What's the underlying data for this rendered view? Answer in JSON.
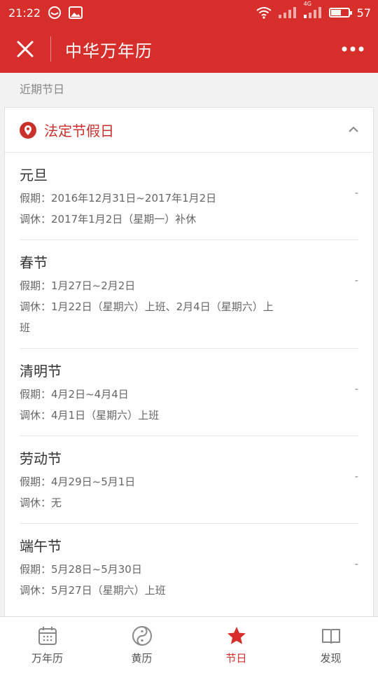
{
  "statusbar": {
    "time": "21:22",
    "signal_label": "4G",
    "battery": "57",
    "battery_level": 0.57
  },
  "header": {
    "title": "中华万年历"
  },
  "section_label": "近期节日",
  "card": {
    "title": "法定节假日"
  },
  "holidays": [
    {
      "name": "元旦",
      "vacation": "假期：2016年12月31日~2017年1月2日",
      "adjust": "调休：2017年1月2日（星期一）补休",
      "status": "-"
    },
    {
      "name": "春节",
      "vacation": "假期：1月27日~2月2日",
      "adjust": "调休：1月22日（星期六）上班、2月4日（星期六）上班",
      "status": "-"
    },
    {
      "name": "清明节",
      "vacation": "假期：4月2日~4月4日",
      "adjust": "调休：4月1日（星期六）上班",
      "status": "-"
    },
    {
      "name": "劳动节",
      "vacation": "假期：4月29日~5月1日",
      "adjust": "调休：无",
      "status": "-"
    },
    {
      "name": "端午节",
      "vacation": "假期：5月28日~5月30日",
      "adjust": "调休：5月27日（星期六）上班",
      "status": "-"
    }
  ],
  "nav": [
    {
      "label": "万年历",
      "icon": "calendar-icon"
    },
    {
      "label": "黄历",
      "icon": "yin-yang-icon"
    },
    {
      "label": "节日",
      "icon": "star-icon"
    },
    {
      "label": "发现",
      "icon": "book-icon"
    }
  ],
  "colors": {
    "brand": "#d62e2a",
    "accent_text": "#c9302c"
  }
}
